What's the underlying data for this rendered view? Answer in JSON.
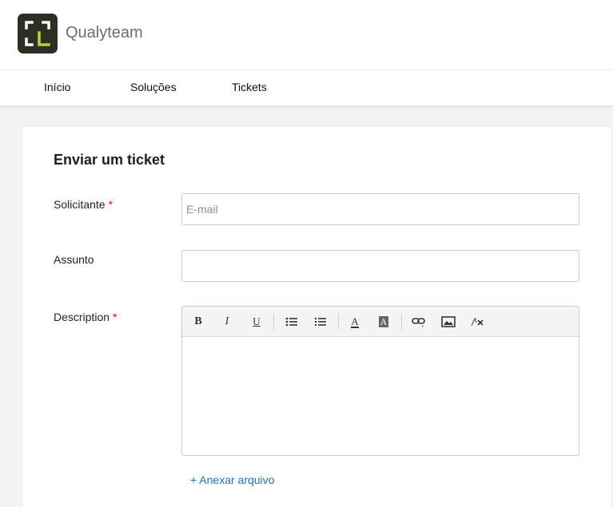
{
  "header": {
    "brand": "Qualyteam",
    "logo_icon": "qualyteam-logo-icon",
    "logo_bg": "#2d2f24",
    "logo_accent": "#b5d334"
  },
  "nav": {
    "items": [
      {
        "label": "Início"
      },
      {
        "label": "Soluções"
      },
      {
        "label": "Tickets"
      }
    ]
  },
  "form": {
    "title": "Enviar um ticket",
    "required_mark": "*",
    "requester": {
      "label": "Solicitante",
      "placeholder": "E-mail",
      "value": ""
    },
    "subject": {
      "label": "Assunto",
      "value": ""
    },
    "description": {
      "label": "Description",
      "value": "",
      "toolbar": {
        "bold": "B",
        "italic": "I",
        "underline": "U",
        "text_color": "A",
        "bg_color": "A",
        "icons": [
          "bold-icon",
          "italic-icon",
          "underline-icon",
          "bulleted-list-icon",
          "numbered-list-icon",
          "text-color-icon",
          "background-color-icon",
          "link-icon",
          "image-icon",
          "clear-format-icon"
        ]
      }
    },
    "attach_label": "+ Anexar arquivo"
  },
  "colors": {
    "required": "#c8102e",
    "link": "#1f73b7",
    "page_bg": "#f2f3f4"
  }
}
